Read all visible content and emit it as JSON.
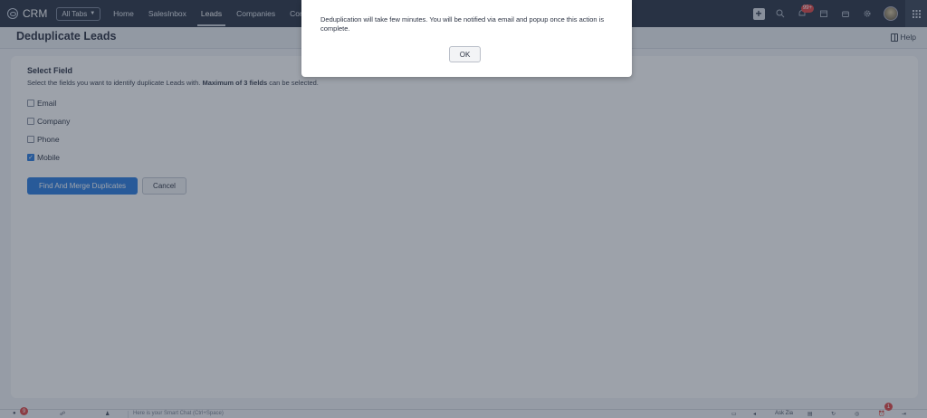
{
  "topnav": {
    "brand": "CRM",
    "all_tabs_label": "All Tabs",
    "links": [
      "Home",
      "SalesInbox",
      "Leads",
      "Companies",
      "Con"
    ],
    "active_link_index": 2,
    "notification_badge": "99+"
  },
  "page": {
    "title": "Deduplicate Leads",
    "help_label": "Help"
  },
  "form": {
    "section_title": "Select Field",
    "instruction_prefix": "Select the fields you want to identify duplicate Leads with.",
    "instruction_bold": "Maximum of 3 fields",
    "instruction_suffix": "can be selected.",
    "fields": [
      {
        "label": "Email",
        "checked": false
      },
      {
        "label": "Company",
        "checked": false
      },
      {
        "label": "Phone",
        "checked": false
      },
      {
        "label": "Mobile",
        "checked": true
      }
    ],
    "primary_button": "Find And Merge Duplicates",
    "cancel_button": "Cancel"
  },
  "bottombar": {
    "smart_chat_placeholder": "Here is your Smart Chat (Ctrl+Space)",
    "ask_zia": "Ask Zia",
    "badge_left": "9",
    "badge_right": "1"
  },
  "dialog": {
    "message": "Deduplication will take few minutes. You will be notified via email and popup once this action is complete.",
    "ok_label": "OK"
  },
  "colors": {
    "nav_bg": "#2b3445",
    "accent": "#2a7de1",
    "overlay": "rgba(38,48,66,0.45)",
    "badge": "#e04646"
  }
}
